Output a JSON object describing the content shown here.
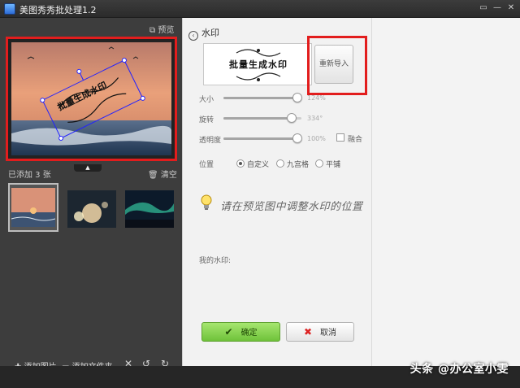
{
  "window": {
    "title": "美图秀秀批处理1.2",
    "controls": [
      "▭",
      "—",
      "✕"
    ]
  },
  "left": {
    "preview_label": "预览",
    "added_count": "已添加 3 张",
    "clear_label": "清空",
    "toolbar": {
      "add_image": "添加图片",
      "add_folder": "添加文件夹"
    }
  },
  "watermark_panel": {
    "title": "水印",
    "watermark_text": "批量生成水印",
    "reimport_label": "重新导入",
    "size": {
      "label": "大小",
      "value": "124%",
      "fraction": 0.95
    },
    "rotation": {
      "label": "旋转",
      "value": "334°",
      "fraction": 0.87
    },
    "opacity": {
      "label": "透明度",
      "value": "100%",
      "fraction": 0.95
    },
    "blend_label": "融合",
    "blend_checked": false,
    "position": {
      "label": "位置",
      "options": [
        "自定义",
        "九宫格",
        "平铺"
      ],
      "selected": 0
    },
    "tip": "请在预览图中调整水印的位置",
    "my_watermark_label": "我的水印:",
    "ok_label": "确定",
    "cancel_label": "取消"
  },
  "credit": "头条 @办公室小雯",
  "colors": {
    "highlight_red": "#e21d1d",
    "ok_green": "#7fcf45",
    "selection_blue": "#2222ff"
  }
}
